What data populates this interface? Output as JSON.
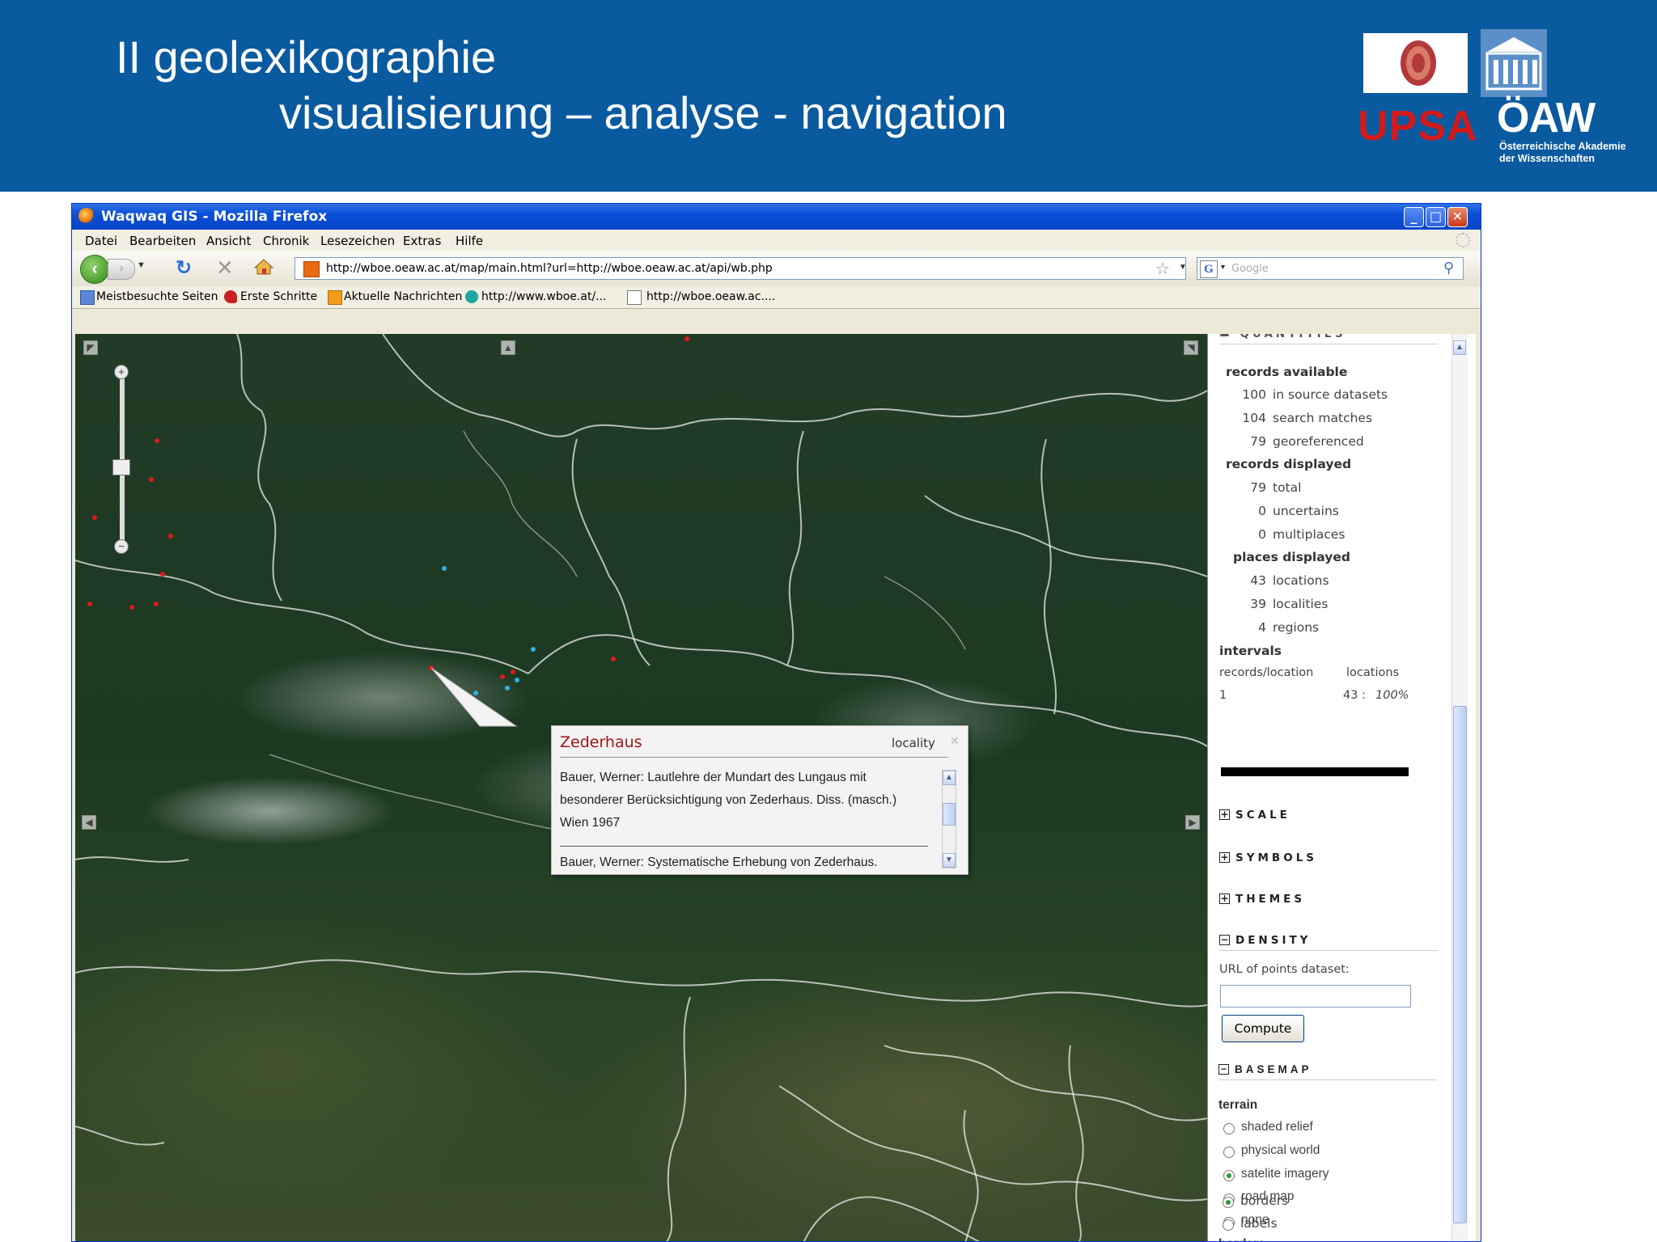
{
  "slide": {
    "title_line1": "II geolexikographie",
    "title_line2": "visualisierung – analyse - navigation",
    "logo_upsa": "UPSA",
    "logo_oaw": "ÖAW",
    "logo_oaw_sub_line1": "Österreichische Akademie",
    "logo_oaw_sub_line2": "der Wissenschaften",
    "header_color": "#0a5aa0"
  },
  "window": {
    "title": "Waqwaq GIS - Mozilla Firefox"
  },
  "menu": [
    "Datei",
    "Bearbeiten",
    "Ansicht",
    "Chronik",
    "Lesezeichen",
    "Extras",
    "Hilfe"
  ],
  "nav": {
    "url": "http://wboe.oeaw.ac.at/map/main.html?url=http://wboe.oeaw.ac.at/api/wb.php",
    "search_placeholder": "Google"
  },
  "bookmarks": [
    "Meistbesuchte Seiten",
    "Erste Schritte",
    "Aktuelle Nachrichten",
    "http://www.wboe.at/...",
    "http://wboe.oeaw.ac...."
  ],
  "popup": {
    "title": "Zederhaus",
    "type": "locality",
    "entries": [
      {
        "line1": "Bauer, Werner: Lautlehre der Mundart des Lungaus mit",
        "line2": "besonderer Berücksichtigung von Zederhaus. Diss. (masch.)",
        "line3": "Wien 1967"
      },
      {
        "line1": "Bauer, Werner: Systematische Erhebung von Zederhaus.",
        "line2": "Zederhaus 1969"
      }
    ]
  },
  "panel": {
    "records_available": {
      "heading": "records available",
      "rows": [
        {
          "value": "100",
          "label": "in source datasets"
        },
        {
          "value": "104",
          "label": "search matches"
        },
        {
          "value": "79",
          "label": "georeferenced"
        }
      ]
    },
    "records_displayed": {
      "heading": "records displayed",
      "rows": [
        {
          "value": "79",
          "label": "total"
        },
        {
          "value": "0",
          "label": "uncertains"
        },
        {
          "value": "0",
          "label": "multiplaces"
        }
      ]
    },
    "places_displayed": {
      "heading": "places displayed",
      "rows": [
        {
          "value": "43",
          "label": "locations"
        },
        {
          "value": "39",
          "label": "localities"
        },
        {
          "value": "4",
          "label": "regions"
        }
      ]
    },
    "intervals": {
      "heading": "intervals",
      "col1": "records/location",
      "col2": "locations",
      "row_value": "1",
      "row_count": "43 :",
      "row_percent": "100%"
    },
    "sections": {
      "scale": "SCALE",
      "symbols": "SYMBOLS",
      "themes": "THEMES",
      "density": "DENSITY",
      "basemap": "BASEMAP"
    },
    "density": {
      "label": "URL of points dataset:",
      "button": "Compute"
    },
    "terrain": {
      "heading": "terrain",
      "options": [
        "shaded relief",
        "physical world",
        "satelite imagery",
        "road map",
        "none"
      ],
      "selected": "satelite imagery"
    },
    "borders": {
      "heading": "borders",
      "options": [
        "borders",
        "labels"
      ],
      "selected": "borders"
    }
  }
}
